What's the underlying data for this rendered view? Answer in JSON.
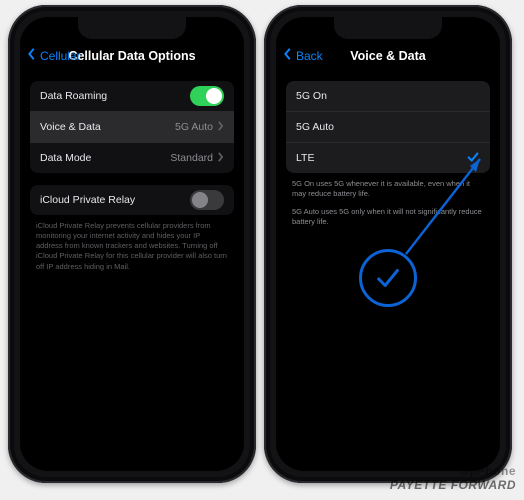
{
  "left": {
    "back_label": "Cellular",
    "title": "Cellular Data Options",
    "group1": {
      "roaming": {
        "label": "Data Roaming",
        "on": true
      },
      "voice": {
        "label": "Voice & Data",
        "value": "5G Auto"
      },
      "mode": {
        "label": "Data Mode",
        "value": "Standard"
      }
    },
    "group2": {
      "relay": {
        "label": "iCloud Private Relay",
        "on": false
      },
      "footer": "iCloud Private Relay prevents cellular providers from monitoring your internet activity and hides your IP address from known trackers and websites. Turning off iCloud Private Relay for this cellular provider will also turn off IP address hiding in Mail."
    }
  },
  "right": {
    "back_label": "Back",
    "title": "Voice & Data",
    "options": {
      "opt0": "5G On",
      "opt1": "5G Auto",
      "opt2": "LTE"
    },
    "footer1": "5G On uses 5G whenever it is available, even when it may reduce battery life.",
    "footer2": "5G Auto uses 5G only when it will not significantly reduce battery life."
  },
  "watermarks": {
    "w1": "UpPhone",
    "w2": "PAYETTE FORWARD"
  }
}
